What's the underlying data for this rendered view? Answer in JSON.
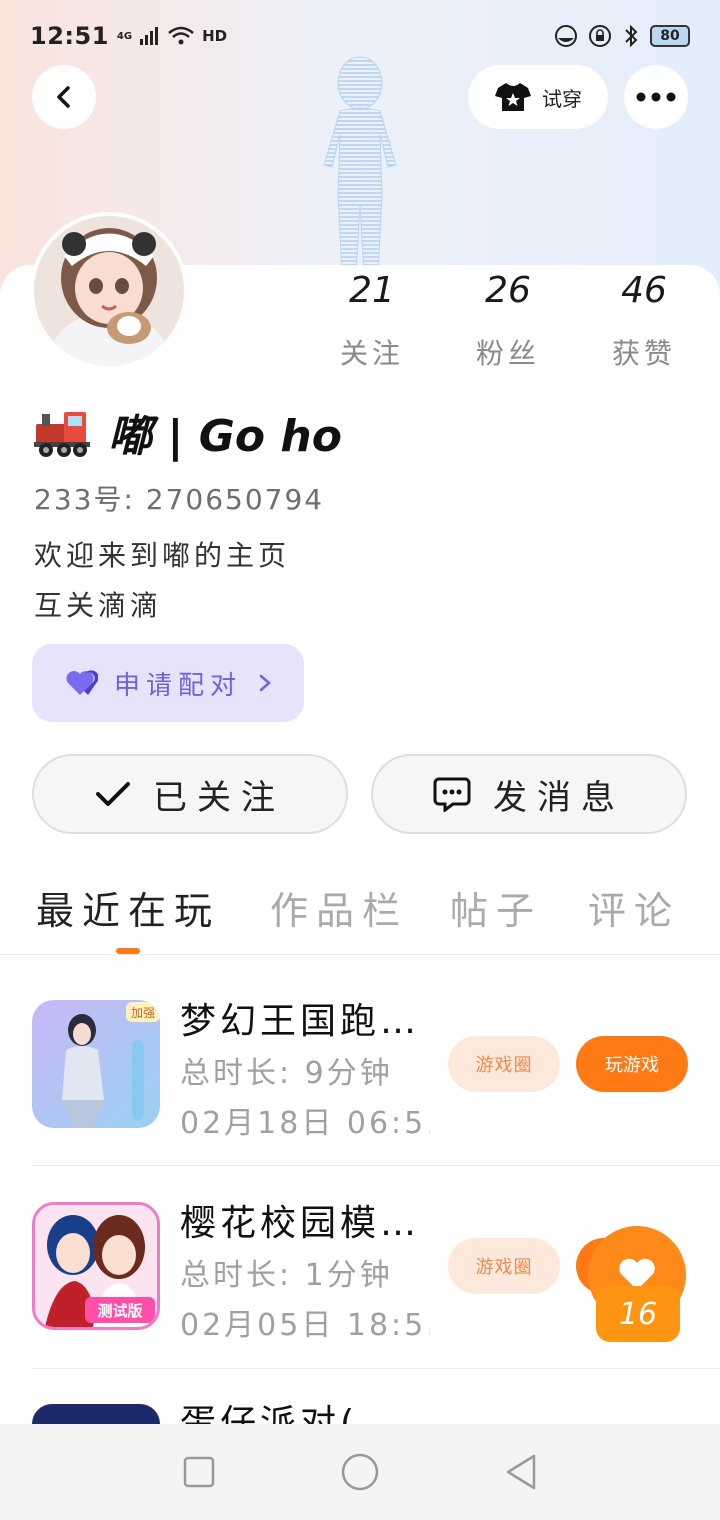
{
  "status_bar": {
    "time": "12:51",
    "network": "4G",
    "hd": "HD",
    "battery": "80"
  },
  "header": {
    "tryon_label": "试穿"
  },
  "profile": {
    "stats": [
      {
        "value": "21",
        "label": "关注"
      },
      {
        "value": "26",
        "label": "粉丝"
      },
      {
        "value": "46",
        "label": "获赞"
      }
    ],
    "name": "嘟 | Go ho",
    "uid": "233号: 270650794",
    "bio_line1": "欢迎来到嘟的主页",
    "bio_line2": "互关滴滴",
    "pair_label": "申请配对",
    "follow_label": "已关注",
    "message_label": "发消息"
  },
  "tabs": [
    {
      "label": "最近在玩",
      "active": true
    },
    {
      "label": "作品栏",
      "active": false
    },
    {
      "label": "帖子",
      "active": false
    },
    {
      "label": "评论",
      "active": false
    }
  ],
  "games": [
    {
      "title": "梦幻王国跑…",
      "duration": "总时长: 9分钟",
      "date": "02月18日 06:5…",
      "badge": "加强",
      "circle_label": "游戏圈",
      "play_label": "玩游戏"
    },
    {
      "title": "樱花校园模…",
      "duration": "总时长: 1分钟",
      "date": "02月05日 18:5…",
      "badge": "测试版",
      "circle_label": "游戏圈"
    },
    {
      "title": "蛋仔派对(…"
    }
  ],
  "like_float": {
    "count": "16"
  },
  "colors": {
    "accent": "#ff7a14",
    "pair_bg": "#e6e3fb",
    "pair_text": "#6e62e0"
  }
}
